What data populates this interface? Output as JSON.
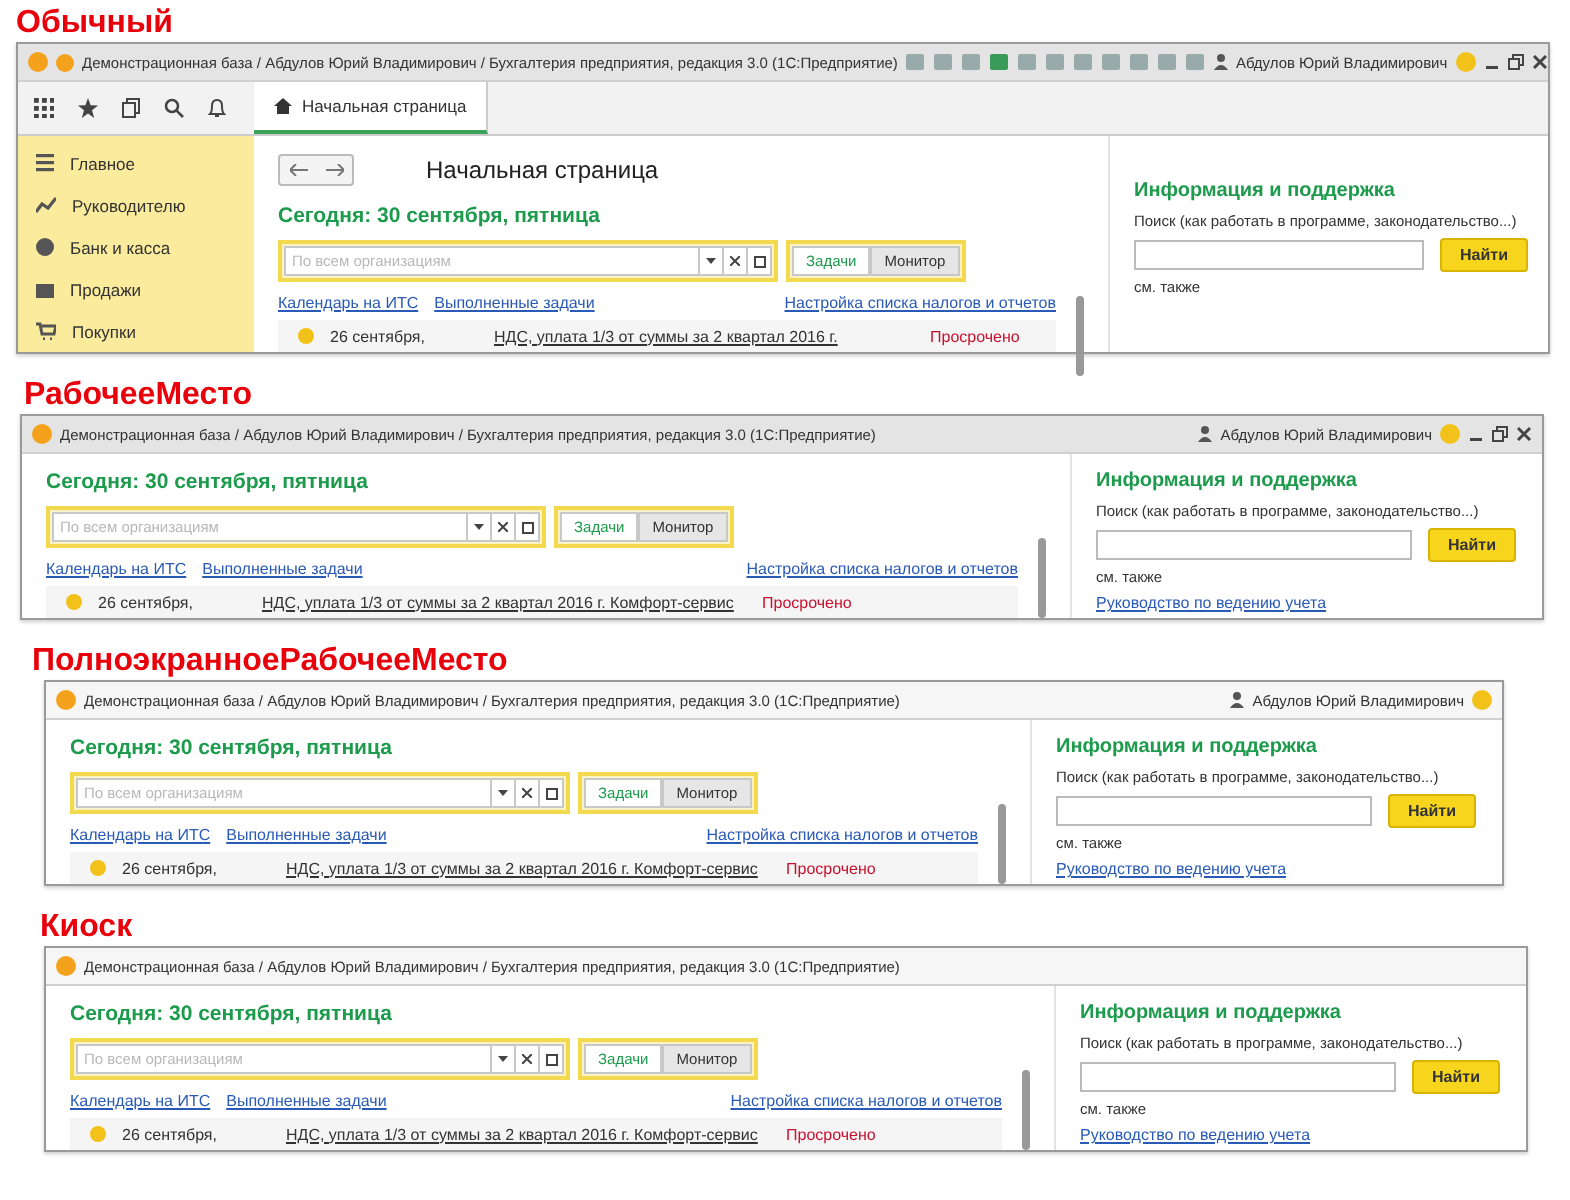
{
  "panels": [
    {
      "heading": "Обычный",
      "title": "Демонстрационная база / Абдулов Юрий Владимирович / Бухгалтерия предприятия, редакция 3.0  (1С:Предприятие)",
      "toolbar": true,
      "user": "Абдулов Юрий Владимирович",
      "window_buttons": true,
      "sidebar": [
        "Главное",
        "Руководителю",
        "Банк и касса",
        "Продажи",
        "Покупки"
      ],
      "tab": "Начальная страница",
      "page_title": "Начальная страница",
      "today": "Сегодня: 30 сентября, пятница",
      "org_placeholder": "По всем организациям",
      "view_buttons": [
        {
          "label": "Задачи",
          "selected": true
        },
        {
          "label": "Монитор",
          "selected": false
        }
      ],
      "links": [
        "Календарь на ИТС",
        "Выполненные задачи"
      ],
      "settings_link": "Настройка списка налогов и отчетов",
      "task": {
        "date": "26 сентября,",
        "name": "НДС, уплата 1/3 от суммы за 2 квартал 2016 г.",
        "status": "Просрочено"
      },
      "info": {
        "title": "Информация и поддержка",
        "search_label": "Поиск (как работать в программе, законодательство...)",
        "find_button": "Найти",
        "see_also": "см. также"
      }
    },
    {
      "heading": "РабочееМесто",
      "title": "Демонстрационная база / Абдулов Юрий Владимирович / Бухгалтерия предприятия, редакция 3.0  (1С:Предприятие)",
      "toolbar": false,
      "user": "Абдулов Юрий Владимирович",
      "window_buttons": true,
      "today": "Сегодня: 30 сентября, пятница",
      "org_placeholder": "По всем организациям",
      "view_buttons": [
        {
          "label": "Задачи",
          "selected": true
        },
        {
          "label": "Монитор",
          "selected": false
        }
      ],
      "links": [
        "Календарь на ИТС",
        "Выполненные задачи"
      ],
      "settings_link": "Настройка списка налогов и отчетов",
      "task": {
        "date": "26 сентября,",
        "name": "НДС, уплата 1/3 от суммы за 2 квартал 2016 г.  Комфорт-сервис",
        "status": "Просрочено"
      },
      "info": {
        "title": "Информация и поддержка",
        "search_label": "Поиск (как работать в программе, законодательство...)",
        "find_button": "Найти",
        "see_also": "см. также",
        "guide_link": "Руководство по ведению учета"
      }
    },
    {
      "heading": "ПолноэкранноеРабочееМесто",
      "title": "Демонстрационная база / Абдулов Юрий Владимирович / Бухгалтерия предприятия, редакция 3.0  (1С:Предприятие)",
      "toolbar": false,
      "user": "Абдулов Юрий Владимирович",
      "window_buttons": false,
      "today": "Сегодня: 30 сентября, пятница",
      "org_placeholder": "По всем организациям",
      "view_buttons": [
        {
          "label": "Задачи",
          "selected": true
        },
        {
          "label": "Монитор",
          "selected": false
        }
      ],
      "links": [
        "Календарь на ИТС",
        "Выполненные задачи"
      ],
      "settings_link": "Настройка списка налогов и отчетов",
      "task": {
        "date": "26 сентября,",
        "name": "НДС, уплата 1/3 от суммы за 2 квартал 2016 г.  Комфорт-сервис",
        "status": "Просрочено"
      },
      "info": {
        "title": "Информация и поддержка",
        "search_label": "Поиск (как работать в программе, законодательство...)",
        "find_button": "Найти",
        "see_also": "см. также",
        "guide_link": "Руководство по ведению учета"
      }
    },
    {
      "heading": "Киоск",
      "title": "Демонстрационная база / Абдулов Юрий Владимирович / Бухгалтерия предприятия, редакция 3.0  (1С:Предприятие)",
      "toolbar": false,
      "window_buttons": false,
      "today": "Сегодня: 30 сентября, пятница",
      "org_placeholder": "По всем организациям",
      "view_buttons": [
        {
          "label": "Задачи",
          "selected": true
        },
        {
          "label": "Монитор",
          "selected": false
        }
      ],
      "links": [
        "Календарь на ИТС",
        "Выполненные задачи"
      ],
      "settings_link": "Настройка списка налогов и отчетов",
      "task": {
        "date": "26 сентября,",
        "name": "НДС, уплата 1/3 от суммы за 2 квартал 2016 г.  Комфорт-сервис",
        "status": "Просрочено"
      },
      "info": {
        "title": "Информация и поддержка",
        "search_label": "Поиск (как работать в программе, законодательство...)",
        "find_button": "Найти",
        "see_also": "см. также",
        "guide_link": "Руководство по ведению учета"
      }
    }
  ]
}
